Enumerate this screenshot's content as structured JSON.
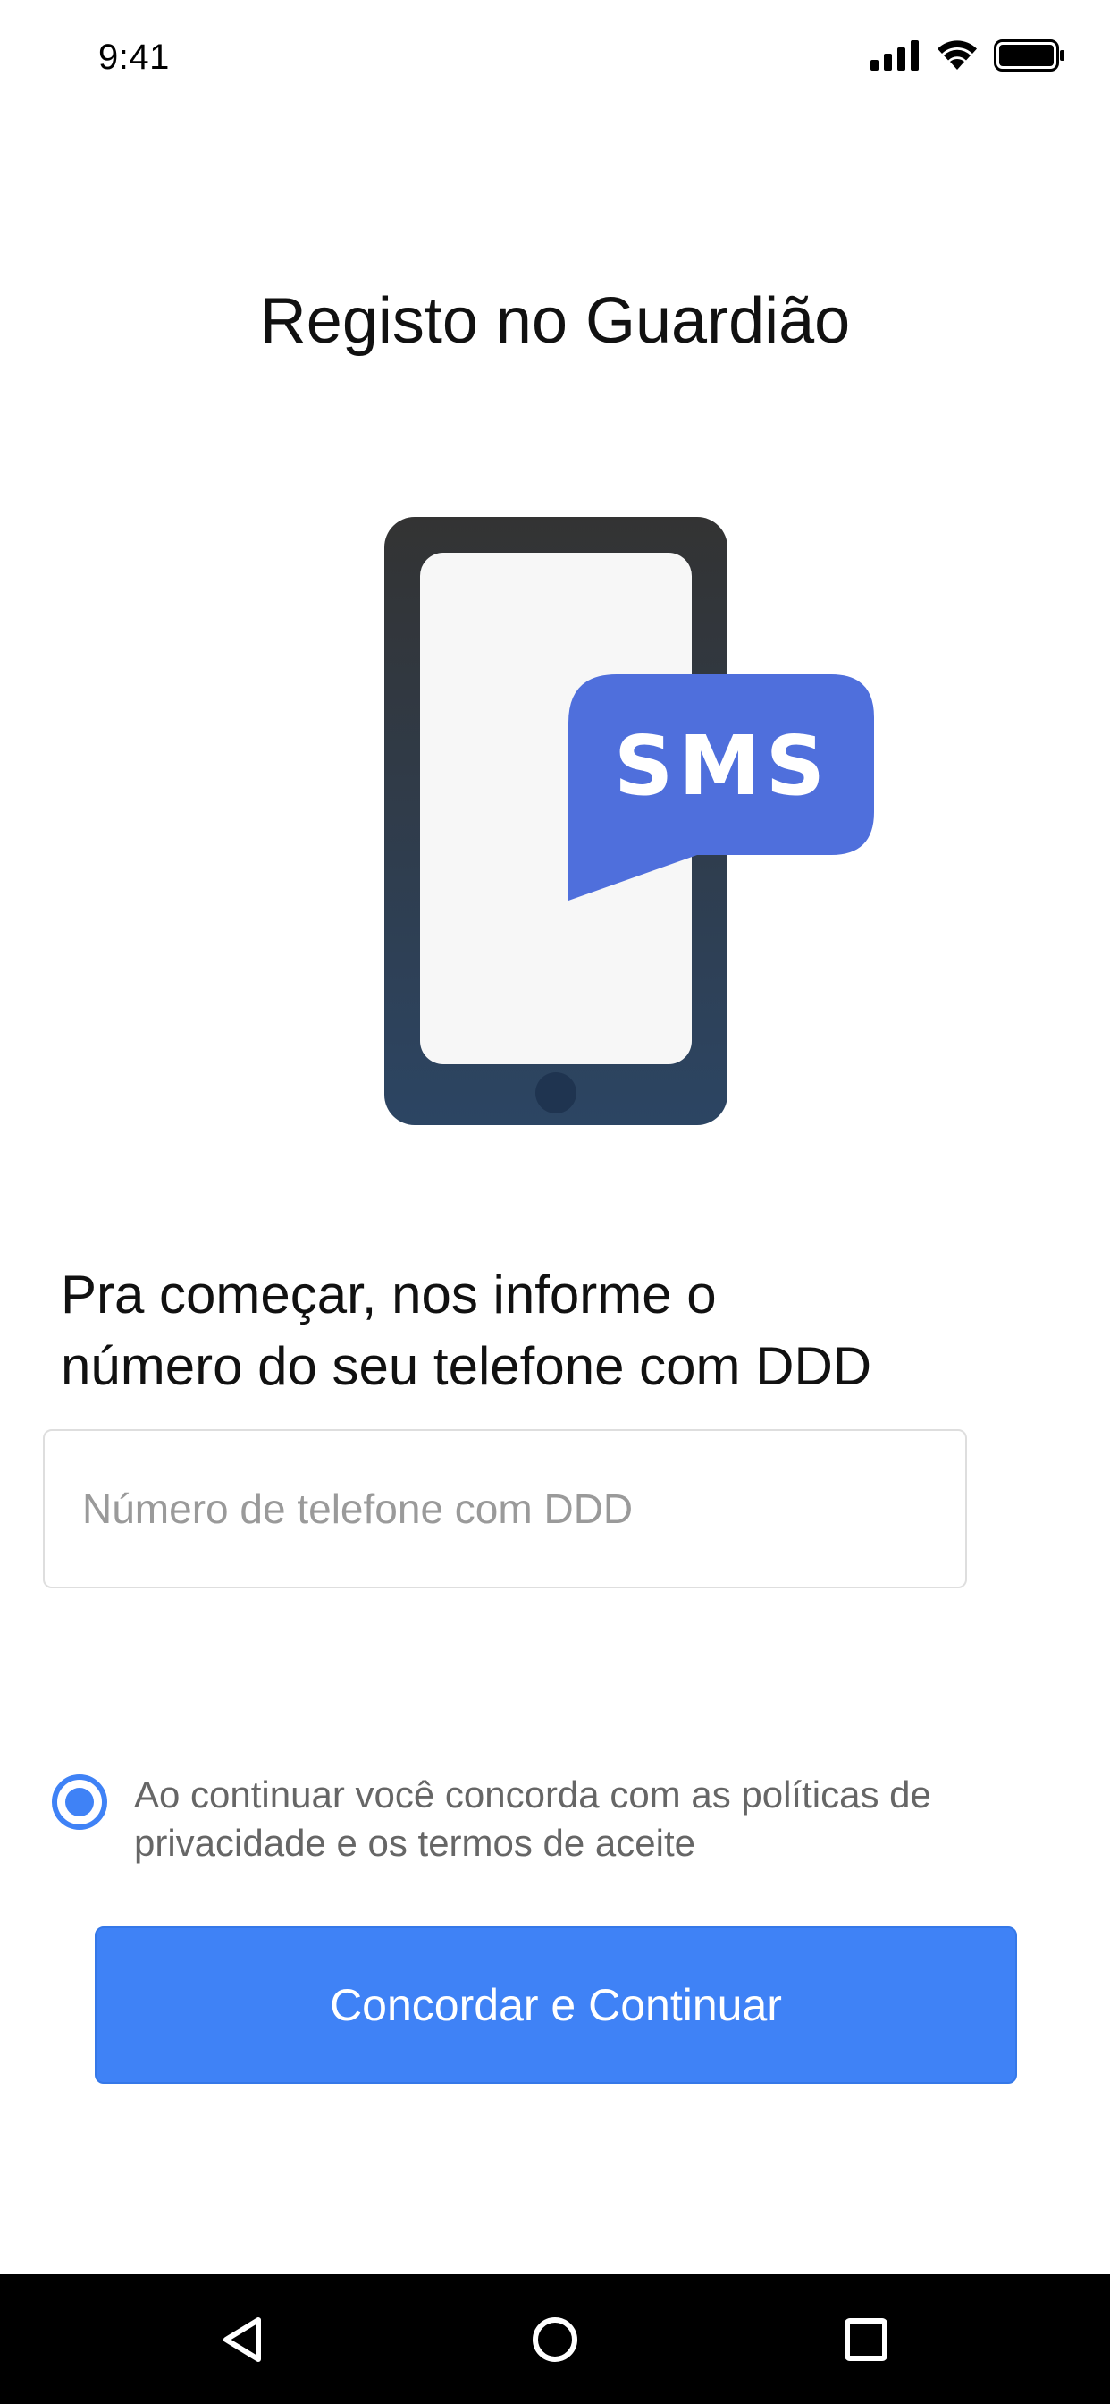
{
  "status_bar": {
    "time": "9:41",
    "icons": [
      "signal-icon",
      "wifi-icon",
      "battery-icon"
    ]
  },
  "header": {
    "title": "Registo no Guardião"
  },
  "illustration": {
    "badge_text": "SMS",
    "badge_color": "#4f6fdc",
    "phone_color_top": "#333333",
    "phone_color_bottom": "#2c4563"
  },
  "form": {
    "prompt_line1": "Pra começar, nos informe o",
    "prompt_line2": "número do seu telefone com DDD",
    "phone_input": {
      "value": "",
      "placeholder": "Número de telefone com DDD"
    },
    "consent": {
      "checked": true,
      "text_line1": "Ao continuar você concorda com as políticas de",
      "text_line2": "privacidade e os termos de aceite"
    },
    "continue_label": "Concordar e Continuar"
  },
  "colors": {
    "accent": "#3f82f6",
    "text_primary": "#111111",
    "text_secondary": "#666666",
    "placeholder": "#9a9a9a"
  },
  "nav_bar": {
    "items": [
      "back-icon",
      "home-icon",
      "recents-icon"
    ]
  }
}
